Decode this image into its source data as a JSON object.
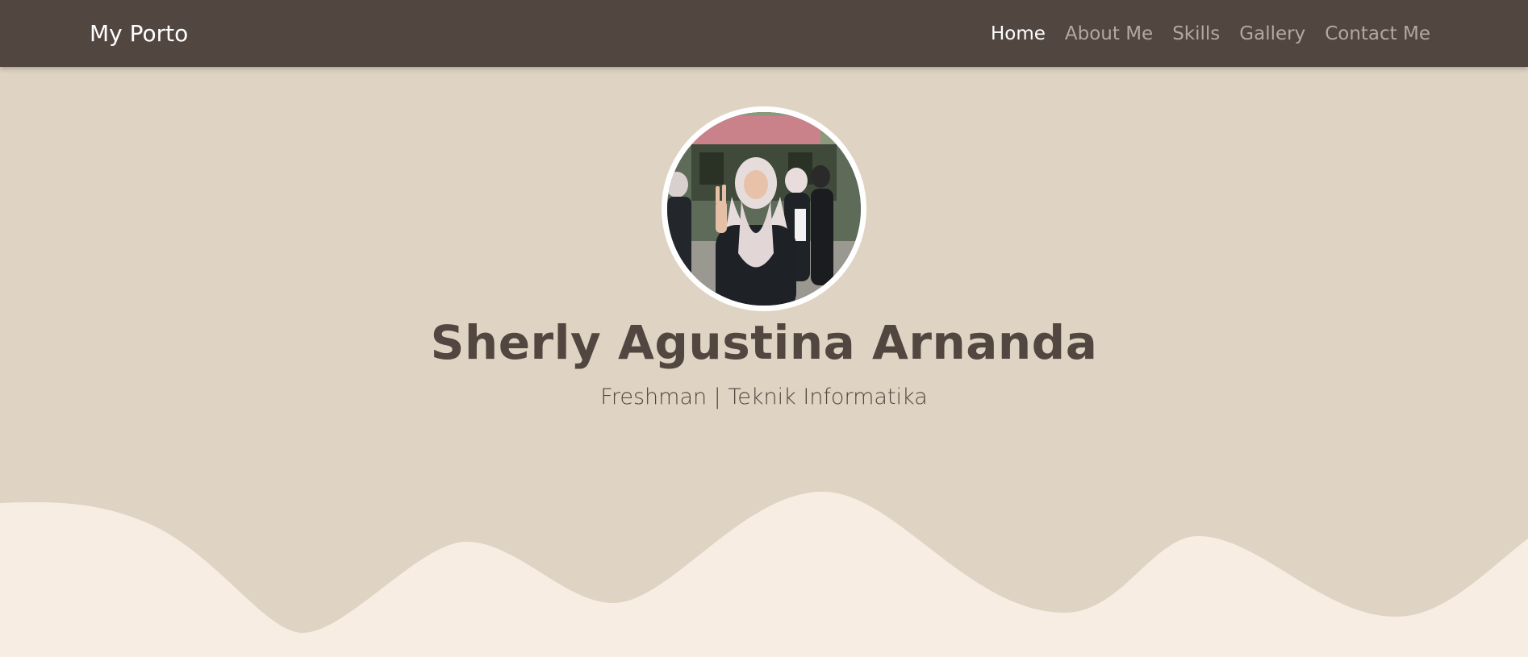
{
  "navbar": {
    "brand": "My Porto",
    "links": [
      {
        "label": "Home",
        "active": true
      },
      {
        "label": "About Me",
        "active": false
      },
      {
        "label": "Skills",
        "active": false
      },
      {
        "label": "Gallery",
        "active": false
      },
      {
        "label": "Contact Me",
        "active": false
      }
    ]
  },
  "hero": {
    "name": "Sherly Agustina Arnanda",
    "tagline": "Freshman | Teknik Informatika",
    "avatar_icon": "profile-photo"
  },
  "colors": {
    "navbar_bg": "#524640",
    "hero_bg": "#dfd3c3",
    "wave_fill": "#f8ede3",
    "text_dark": "#524640",
    "nav_link": "#b2a89f",
    "nav_active": "#ffffff"
  }
}
